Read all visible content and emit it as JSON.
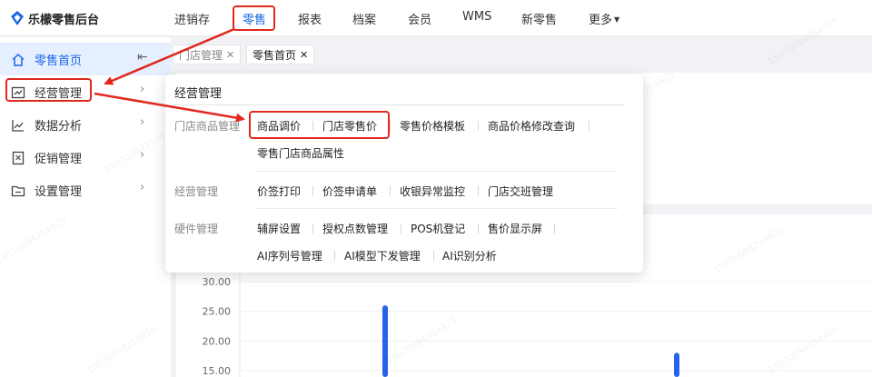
{
  "app": {
    "title": "乐檬零售后台"
  },
  "topnav": [
    {
      "label": "进销存"
    },
    {
      "label": "零售"
    },
    {
      "label": "报表"
    },
    {
      "label": "档案"
    },
    {
      "label": "会员"
    },
    {
      "label": "WMS"
    },
    {
      "label": "新零售"
    },
    {
      "label": "更多"
    }
  ],
  "sidebar": {
    "items": [
      {
        "label": "零售首页"
      },
      {
        "label": "经营管理"
      },
      {
        "label": "数据分析"
      },
      {
        "label": "促销管理"
      },
      {
        "label": "设置管理"
      }
    ]
  },
  "tabs": [
    {
      "label": "门店管理"
    },
    {
      "label": "零售首页"
    }
  ],
  "dropdown": {
    "title": "经营管理",
    "groups": [
      {
        "label": "门店商品管理",
        "links": [
          "商品调价",
          "门店零售价",
          "零售价格模板",
          "商品价格修改查询",
          "零售门店商品属性"
        ]
      },
      {
        "label": "经营管理",
        "links": [
          "价签打印",
          "价签申请单",
          "收银异常监控",
          "门店交班管理"
        ]
      },
      {
        "label": "硬件管理",
        "links": [
          "辅屏设置",
          "授权点数管理",
          "POS机登记",
          "售价显示屏",
          "AI序列号管理",
          "AI模型下发管理",
          "AI识别分析"
        ]
      }
    ]
  },
  "chart_data": {
    "type": "bar",
    "y_tick_labels": [
      "30.00",
      "25.00",
      "20.00",
      "15.00"
    ],
    "ylim": [
      15,
      30
    ],
    "grid": true,
    "series": [
      {
        "values": [
          26,
          18
        ]
      }
    ],
    "bar_color": "#2563eb"
  },
  "watermark": {
    "text": "15070094254425"
  },
  "colors": {
    "accent": "#1a66e6",
    "annotation": "#e0281f",
    "active_bg": "#e6efff"
  }
}
